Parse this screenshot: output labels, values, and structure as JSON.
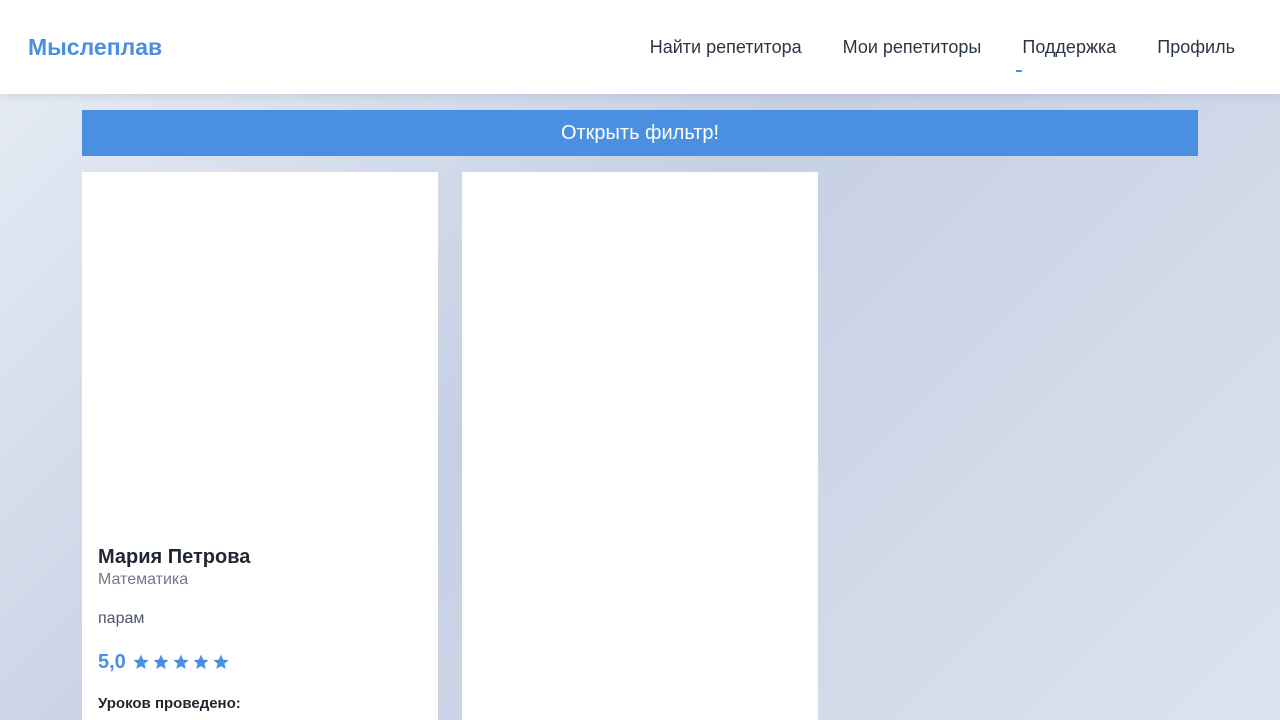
{
  "header": {
    "logo": "Мыслеплав",
    "nav": [
      {
        "label": "Найти репетитора"
      },
      {
        "label": "Мои репетиторы"
      },
      {
        "label": "Поддержка"
      },
      {
        "label": "Профиль"
      }
    ]
  },
  "filter": {
    "button_label": "Открыть фильтр!"
  },
  "cards": [
    {
      "name": "Мария Петрова",
      "subject": "Математика",
      "description": "парам",
      "rating": "5,0",
      "stars": 5,
      "lessons_label": "Уроков проведено:"
    }
  ],
  "colors": {
    "accent": "#4a8fe0",
    "text": "#2b3645"
  },
  "icons": {
    "star": "star-icon"
  }
}
